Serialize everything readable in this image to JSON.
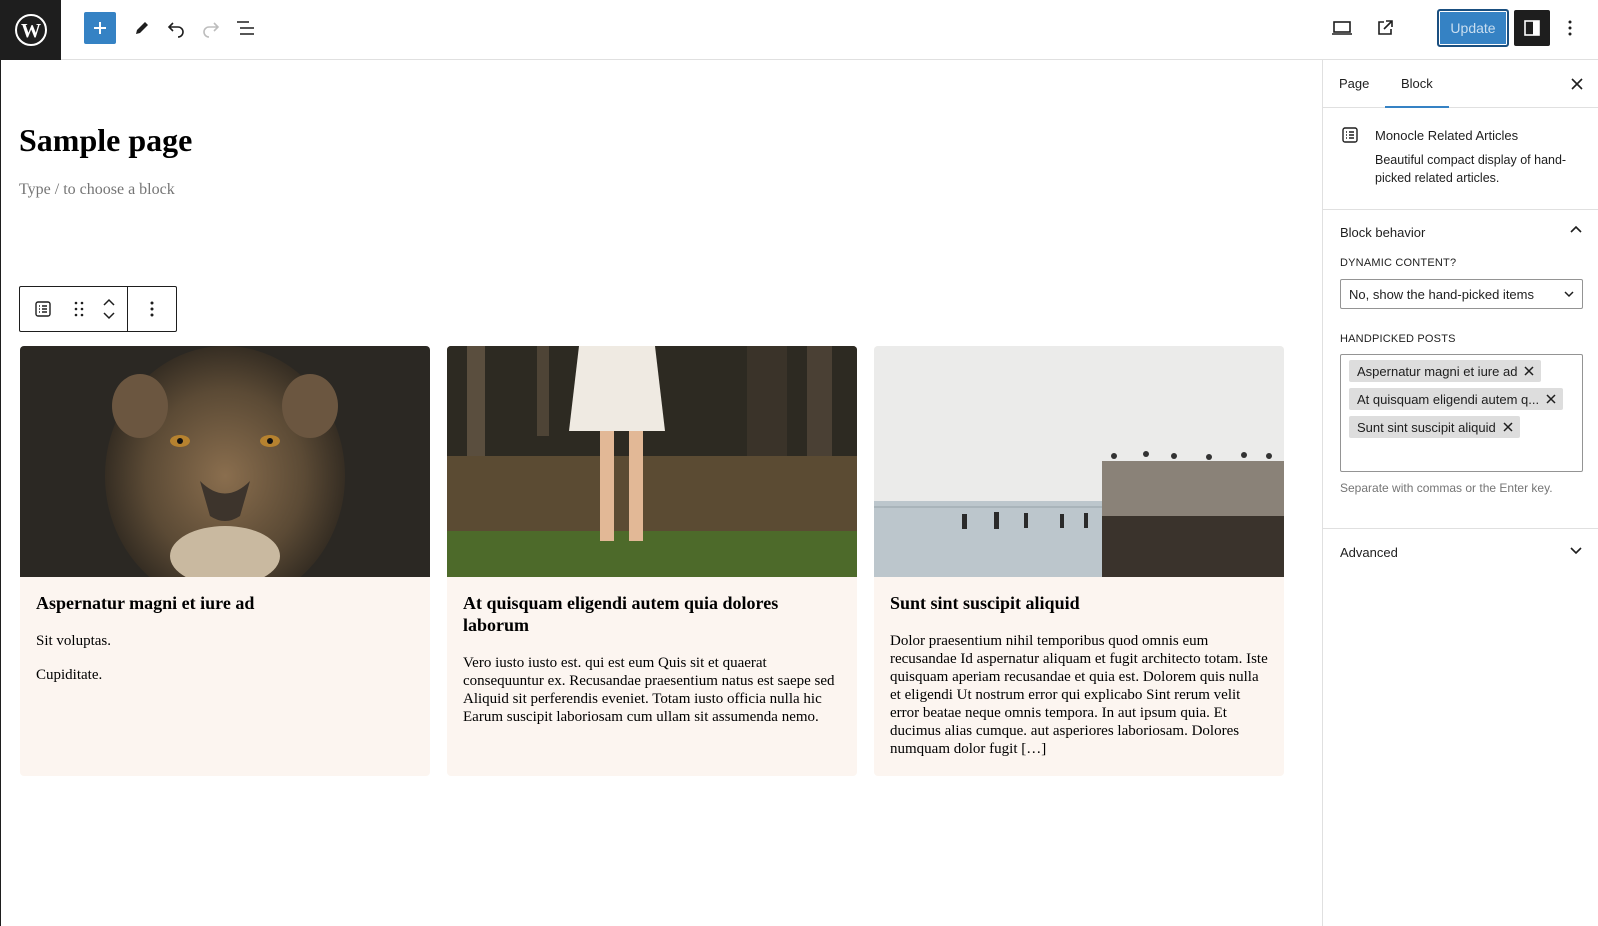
{
  "toolbar": {
    "update_label": "Update"
  },
  "editor": {
    "page_title": "Sample page",
    "block_hint": "Type / to choose a block"
  },
  "cards": [
    {
      "title": "Aspernatur magni et iure ad",
      "paragraphs": [
        "Sit voluptas.",
        "Cupiditate."
      ]
    },
    {
      "title": "At quisquam eligendi autem quia dolores laborum",
      "paragraphs": [
        "Vero iusto iusto est. qui est eum Quis sit et quaerat consequuntur ex. Recusandae praesentium natus est saepe sed Aliquid sit perferendis eveniet. Totam iusto officia nulla hic Earum suscipit laboriosam cum ullam sit assumenda nemo."
      ]
    },
    {
      "title": "Sunt sint suscipit aliquid",
      "paragraphs": [
        "Dolor praesentium nihil temporibus quod omnis eum recusandae Id aspernatur aliquam et fugit architecto totam. Iste quisquam aperiam recusandae et quia est. Dolorem quis nulla et eligendi Ut nostrum error qui explicabo Sint rerum velit error beatae neque omnis tempora. In aut ipsum quia. Et ducimus alias cumque. aut asperiores laboriosam. Dolores numquam dolor fugit […]"
      ]
    }
  ],
  "sidebar": {
    "tabs": [
      "Page",
      "Block"
    ],
    "active_tab": "Block",
    "block": {
      "title": "Monocle Related Articles",
      "description": "Beautiful compact display of hand-picked related articles."
    },
    "behavior": {
      "title": "Block behavior",
      "dynamic_label": "DYNAMIC CONTENT?",
      "dynamic_value": "No, show the hand-picked items",
      "handpicked_label": "HANDPICKED POSTS",
      "tokens": [
        "Aspernatur magni et iure ad",
        "At quisquam eligendi autem q...",
        "Sunt sint suscipit aliquid"
      ],
      "help": "Separate with commas or the Enter key."
    },
    "advanced_title": "Advanced"
  },
  "colors": {
    "accent": "#3582c4",
    "dark": "#1e1e1e",
    "card_bg": "#fcf5f0"
  }
}
